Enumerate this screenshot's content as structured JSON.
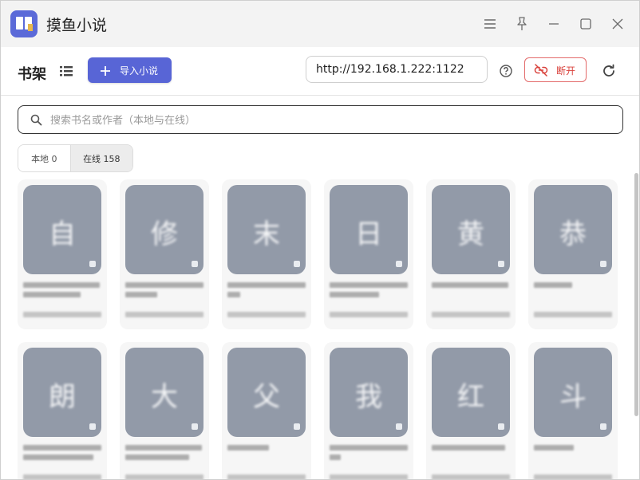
{
  "window": {
    "title": "摸鱼小说",
    "controls": [
      "menu-icon",
      "pin-icon",
      "minimize-icon",
      "maximize-icon",
      "close-icon"
    ]
  },
  "toolbar": {
    "shelf_label": "书架",
    "import_label": "导入小说",
    "server_url": "http://192.168.1.222:1122",
    "disconnect_label": "断开",
    "accent": "#5865d6",
    "danger": "#d9413b"
  },
  "search": {
    "placeholder": "搜索书名或作者（本地与在线）",
    "value": ""
  },
  "tabs": {
    "local_label": "本地 0",
    "online_label": "在线 158",
    "selected": "online"
  },
  "books": [
    {
      "cover_char": "自"
    },
    {
      "cover_char": "修"
    },
    {
      "cover_char": "末"
    },
    {
      "cover_char": "日"
    },
    {
      "cover_char": "黄"
    },
    {
      "cover_char": "恭"
    },
    {
      "cover_char": "朗"
    },
    {
      "cover_char": "大"
    },
    {
      "cover_char": "父"
    },
    {
      "cover_char": "我"
    },
    {
      "cover_char": "红"
    },
    {
      "cover_char": "斗"
    }
  ],
  "colors": {
    "cover_placeholder": "#929aa8",
    "tab_selected_bg": "#ececec"
  }
}
